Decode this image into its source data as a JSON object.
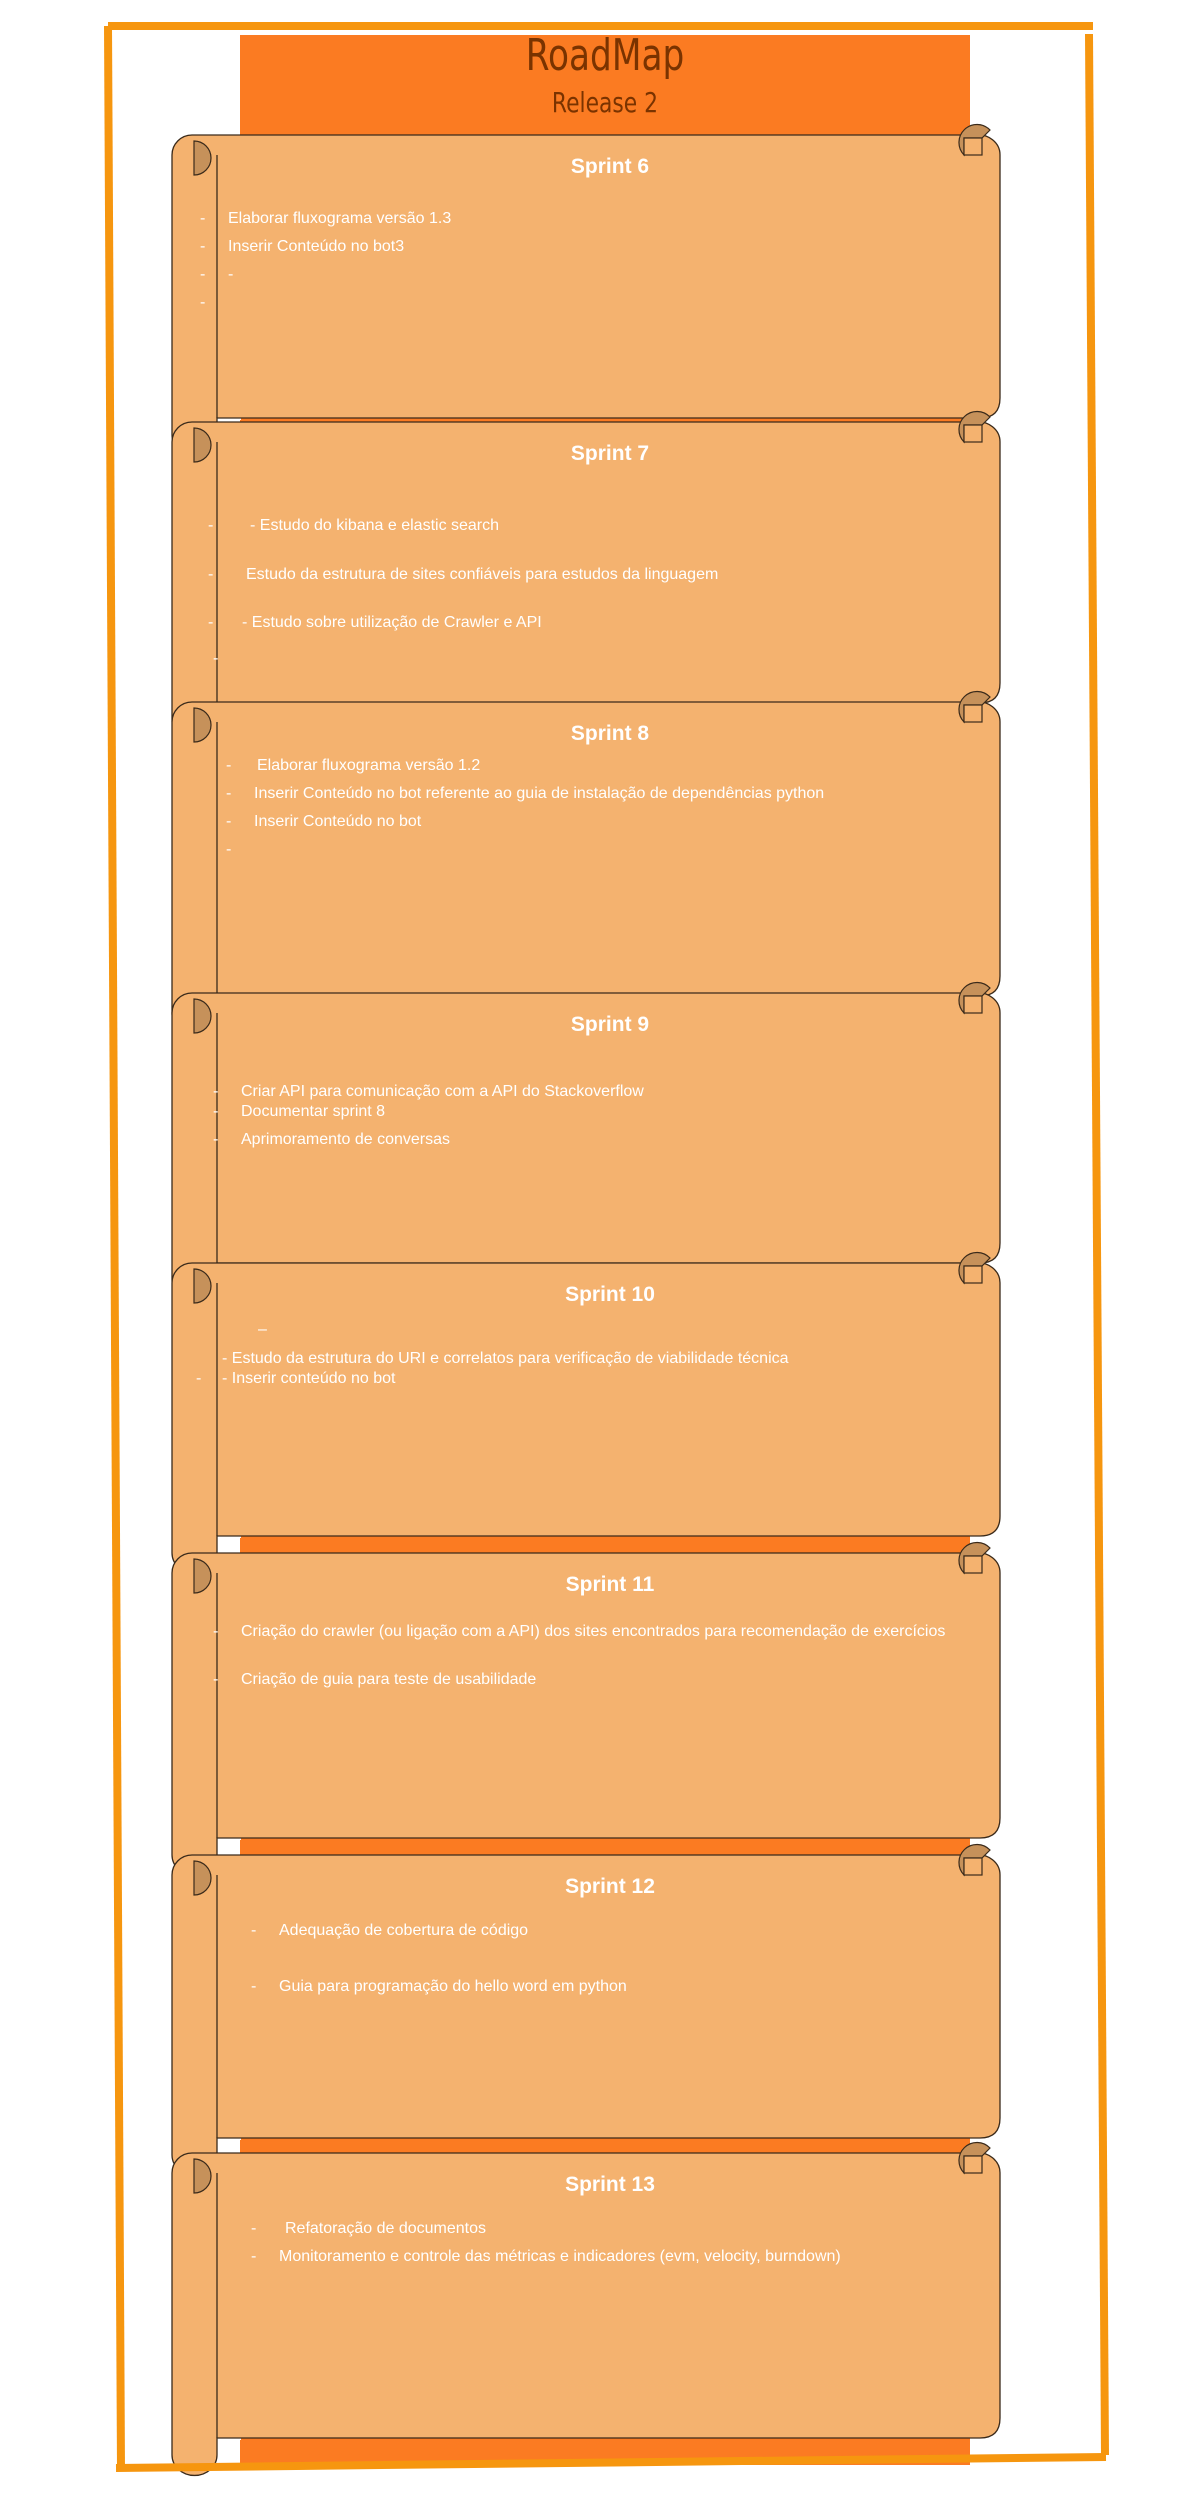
{
  "roadmap": {
    "title": "RoadMap",
    "subtitle": "Release 2"
  },
  "colors": {
    "border": "#f6960f",
    "banner": "#fb7b22",
    "scroll_fill": "#f4b26f",
    "scroll_curl": "#c6915a",
    "text": "#ffffff"
  },
  "sprints": [
    {
      "title": "Sprint 6",
      "items": [
        {
          "bullet": "-",
          "text": "Elaborar fluxograma versão 1.3"
        },
        {
          "bullet": "-",
          "text": "Inserir Conteúdo no bot3"
        },
        {
          "bullet": "-",
          "text": "-"
        },
        {
          "bullet": "-",
          "text": ""
        }
      ]
    },
    {
      "title": "Sprint 7",
      "items": [
        {
          "bullet": "-",
          "text": "- Estudo do kibana e elastic search"
        },
        {
          "bullet": "-",
          "text": "Estudo da estrutura de sites confiáveis para estudos da linguagem"
        },
        {
          "bullet": "-",
          "text": "- Estudo sobre utilização de Crawler e API"
        },
        {
          "bullet": "-",
          "text": ""
        }
      ]
    },
    {
      "title": "Sprint 8",
      "items": [
        {
          "bullet": "-",
          "text": "Elaborar fluxograma versão 1.2"
        },
        {
          "bullet": "-",
          "text": "Inserir Conteúdo no bot referente ao guia de instalação de dependências python"
        },
        {
          "bullet": "-",
          "text": "Inserir Conteúdo no bot"
        },
        {
          "bullet": "-",
          "text": ""
        }
      ]
    },
    {
      "title": "Sprint 9",
      "items": [
        {
          "bullet": "-",
          "text": "Criar API para comunicação com a API do Stackoverflow"
        },
        {
          "bullet": "-",
          "text": "Documentar sprint 8"
        },
        {
          "bullet": "-",
          "text": "Aprimoramento de conversas"
        }
      ]
    },
    {
      "title": "Sprint 10",
      "items": [
        {
          "bullet": "",
          "text": "–"
        },
        {
          "bullet": "",
          "text": "- Estudo da estrutura do URI e correlatos para verificação de viabilidade técnica"
        },
        {
          "bullet": "-",
          "text": "- Inserir conteúdo no bot"
        }
      ]
    },
    {
      "title": "Sprint 11",
      "items": [
        {
          "bullet": "-",
          "text": "Criação do crawler (ou ligação com a API) dos sites encontrados para recomendação de exercícios"
        },
        {
          "bullet": "-",
          "text": "Criação de guia para teste de usabilidade"
        }
      ]
    },
    {
      "title": "Sprint 12",
      "items": [
        {
          "bullet": "-",
          "text": "Adequação de cobertura de código"
        },
        {
          "bullet": "-",
          "text": "Guia para  programação do hello word em python"
        }
      ]
    },
    {
      "title": "Sprint 13",
      "items": [
        {
          "bullet": "-",
          "text": "Refatoração de  documentos"
        },
        {
          "bullet": "-",
          "text": "Monitoramento e controle das métricas e indicadores (evm, velocity, burndown)"
        }
      ]
    }
  ]
}
